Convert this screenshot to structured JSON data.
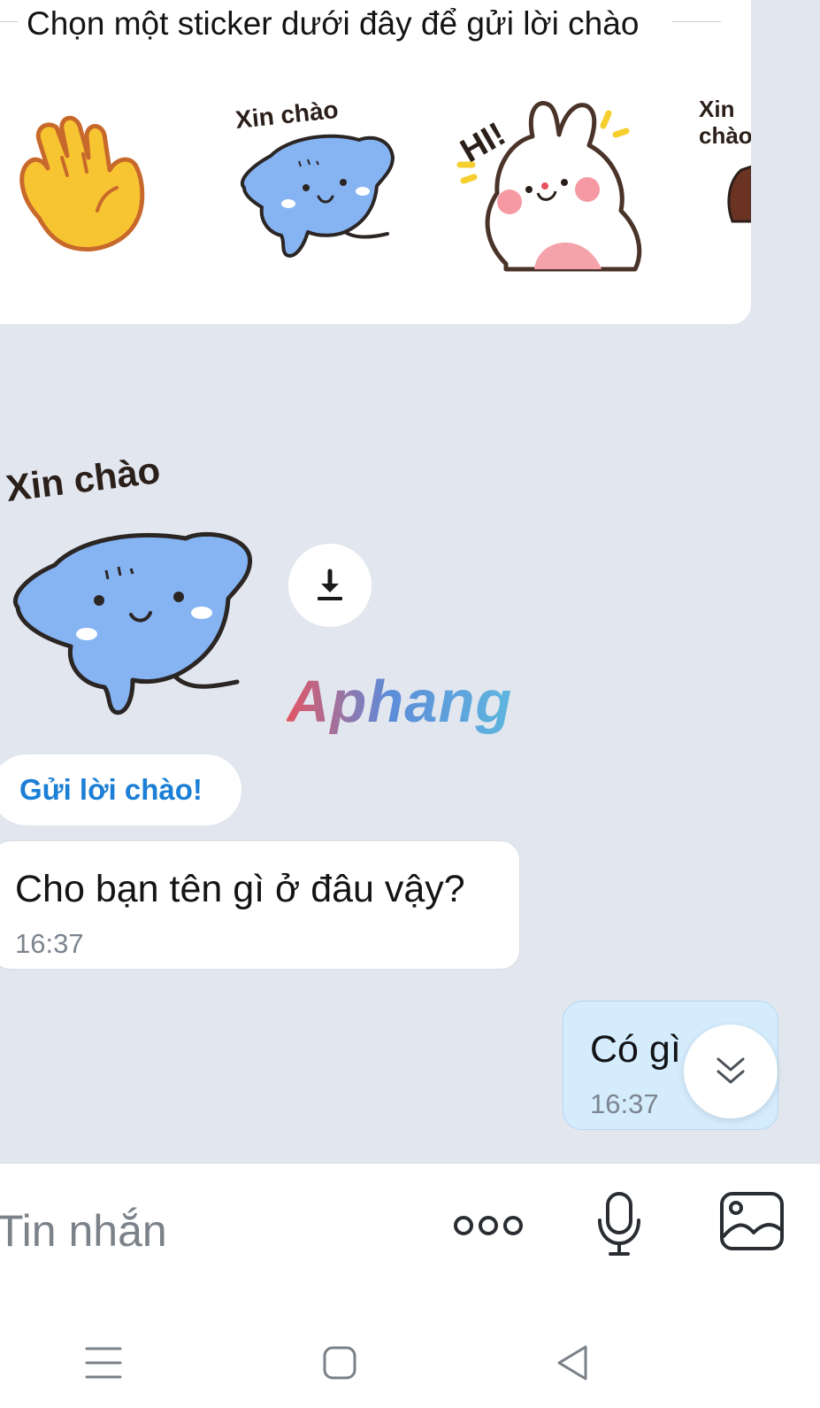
{
  "sticker_panel": {
    "title": "Chọn một sticker dưới đây để gửi lời chào",
    "stickers": [
      {
        "icon": "waving-hand-icon"
      },
      {
        "icon": "blue-cat-sticker",
        "caption": "Xin chào"
      },
      {
        "icon": "white-bunny-sticker",
        "caption": "HI!"
      },
      {
        "icon": "partial-sticker",
        "caption": "Xin chào"
      }
    ]
  },
  "received_sticker": {
    "caption": "Xin chào",
    "download_icon": "download-icon"
  },
  "watermark": "Aphang",
  "greet_button_label": "Gửi lời chào!",
  "messages": [
    {
      "direction": "in",
      "text": "Cho bạn tên gì ở đâu vậy?",
      "time": "16:37"
    },
    {
      "direction": "out",
      "text": "Có gì",
      "time": "16:37"
    }
  ],
  "scroll_down_icon": "chevrons-down-icon",
  "input_bar": {
    "placeholder": "Tin nhắn",
    "more_icon": "more-dots-icon",
    "mic_icon": "microphone-icon",
    "image_icon": "image-icon"
  },
  "nav_bar": {
    "menu_icon": "menu-icon",
    "home_icon": "home-square-icon",
    "back_icon": "back-triangle-icon"
  },
  "colors": {
    "background": "#e2e7ef",
    "accent": "#1c7fd6",
    "outgoing_bubble": "#d5ecfd"
  }
}
